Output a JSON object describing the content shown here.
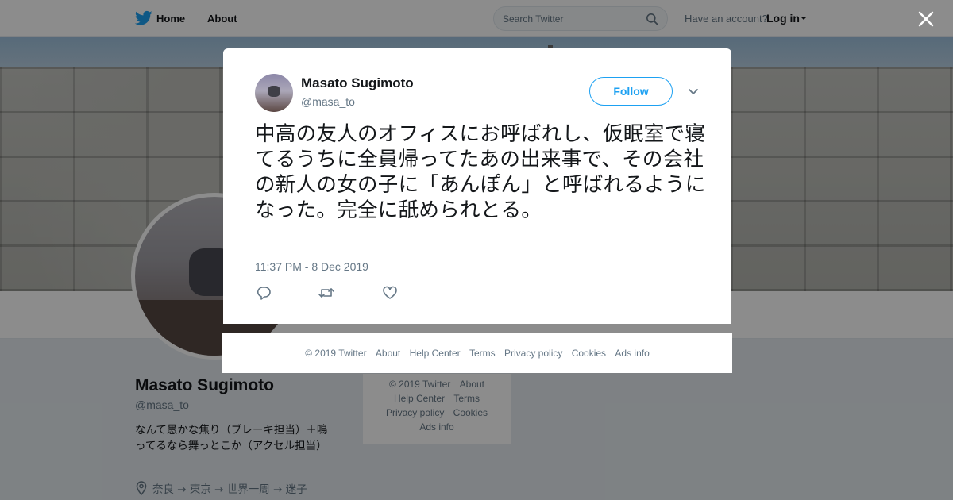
{
  "nav": {
    "home_label": "Home",
    "about_label": "About",
    "search_placeholder": "Search Twitter",
    "have_account": "Have an account?",
    "login_label": "Log in"
  },
  "profile": {
    "name": "Masato Sugimoto",
    "handle": "@masa_to",
    "bio": "なんて愚かな焦り（ブレーキ担当）＋鳴ってるなら舞っとこか（アクセル担当）",
    "location": "奈良 → 東京 → 世界一周 → 迷子"
  },
  "side_footer": {
    "copyright": "© 2019 Twitter",
    "about": "About",
    "help_center": "Help Center",
    "terms": "Terms",
    "privacy": "Privacy policy",
    "cookies": "Cookies",
    "ads_info": "Ads info"
  },
  "tweet": {
    "name": "Masato Sugimoto",
    "handle": "@masa_to",
    "follow_label": "Follow",
    "text": "中高の友人のオフィスにお呼ばれし、仮眠室で寝てるうちに全員帰ってたあの出来事で、その会社の新人の女の子に「あんぽん」と呼ばれるようになった。完全に舐められとる。",
    "timestamp": "11:37 PM - 8 Dec 2019"
  },
  "modal_footer": {
    "copyright": "© 2019 Twitter",
    "about": "About",
    "help_center": "Help Center",
    "terms": "Terms",
    "privacy": "Privacy policy",
    "cookies": "Cookies",
    "ads_info": "Ads info"
  },
  "icons": {
    "brand": "twitter-bird-icon",
    "search": "search-icon",
    "close": "close-icon",
    "reply": "reply-icon",
    "retweet": "retweet-icon",
    "like": "heart-icon",
    "location": "location-pin-icon",
    "menu": "chevron-down-icon"
  },
  "colors": {
    "accent": "#1da1f2",
    "text": "#14171a",
    "muted": "#657786",
    "overlay": "rgba(0,0,0,0.45)"
  }
}
